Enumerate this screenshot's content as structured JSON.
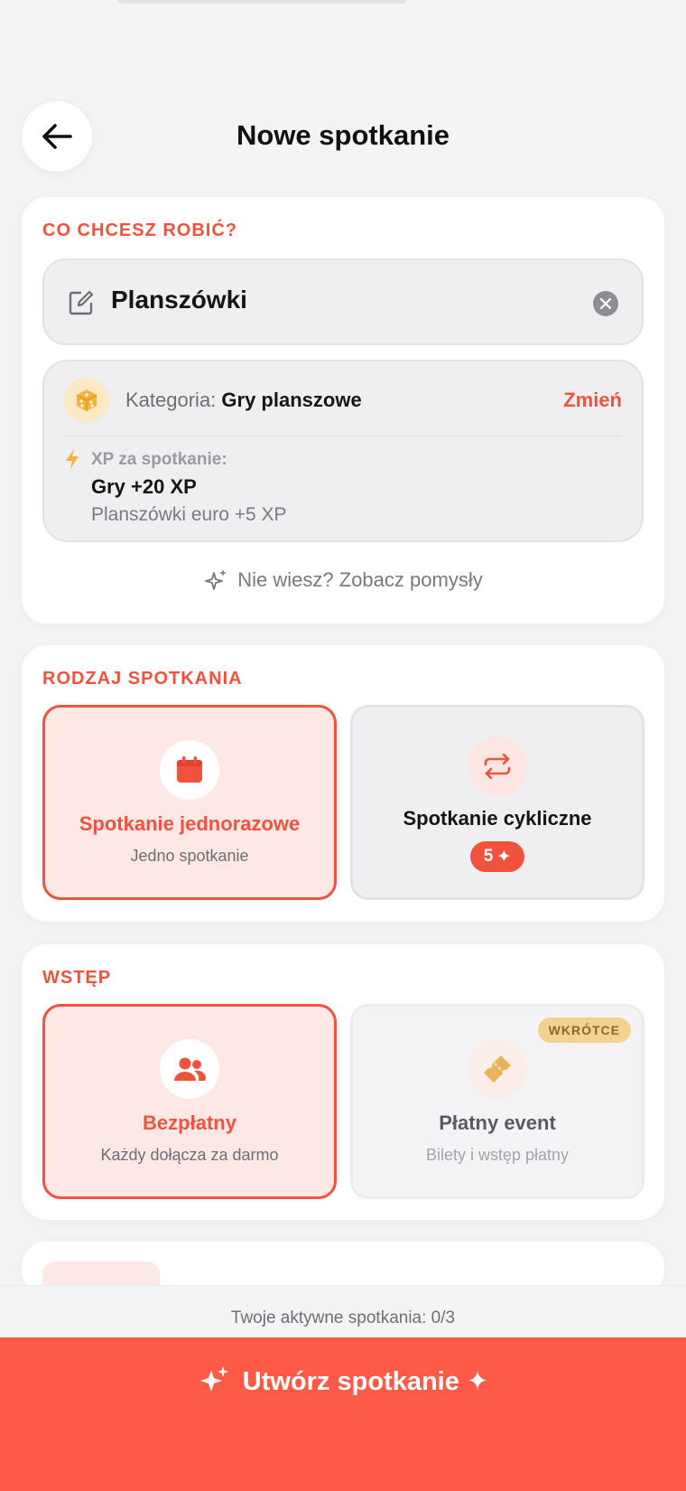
{
  "header": {
    "title": "Nowe spotkanie"
  },
  "activity": {
    "section_label": "CO CHCESZ ROBIĆ?",
    "input_value": "Planszówki",
    "category_prefix": "Kategoria: ",
    "category_value": "Gry planszowe",
    "change_label": "Zmień",
    "xp_label": "XP za spotkanie:",
    "xp_primary": "Gry +20 XP",
    "xp_secondary": "Planszówki euro +5 XP",
    "ideas_label": "Nie wiesz? Zobacz pomysły"
  },
  "meeting_type": {
    "section_label": "RODZAJ SPOTKANIA",
    "options": [
      {
        "title": "Spotkanie jednorazowe",
        "subtitle": "Jedno spotkanie",
        "selected": true
      },
      {
        "title": "Spotkanie cykliczne",
        "cost": "5",
        "selected": false
      }
    ]
  },
  "entry": {
    "section_label": "WSTĘP",
    "options": [
      {
        "title": "Bezpłatny",
        "subtitle": "Każdy dołącza za darmo",
        "selected": true
      },
      {
        "title": "Płatny event",
        "subtitle": "Bilety i wstęp płatny",
        "badge": "WKRÓTCE",
        "selected": false
      }
    ]
  },
  "footer": {
    "active_count": "Twoje aktywne spotkania: 0/3",
    "cta_label": "Utwórz spotkanie ✦"
  },
  "colors": {
    "accent": "#f0533d",
    "cta": "#ff5a47",
    "background": "#f4f4f6",
    "selected_tile": "#fde8e5"
  }
}
